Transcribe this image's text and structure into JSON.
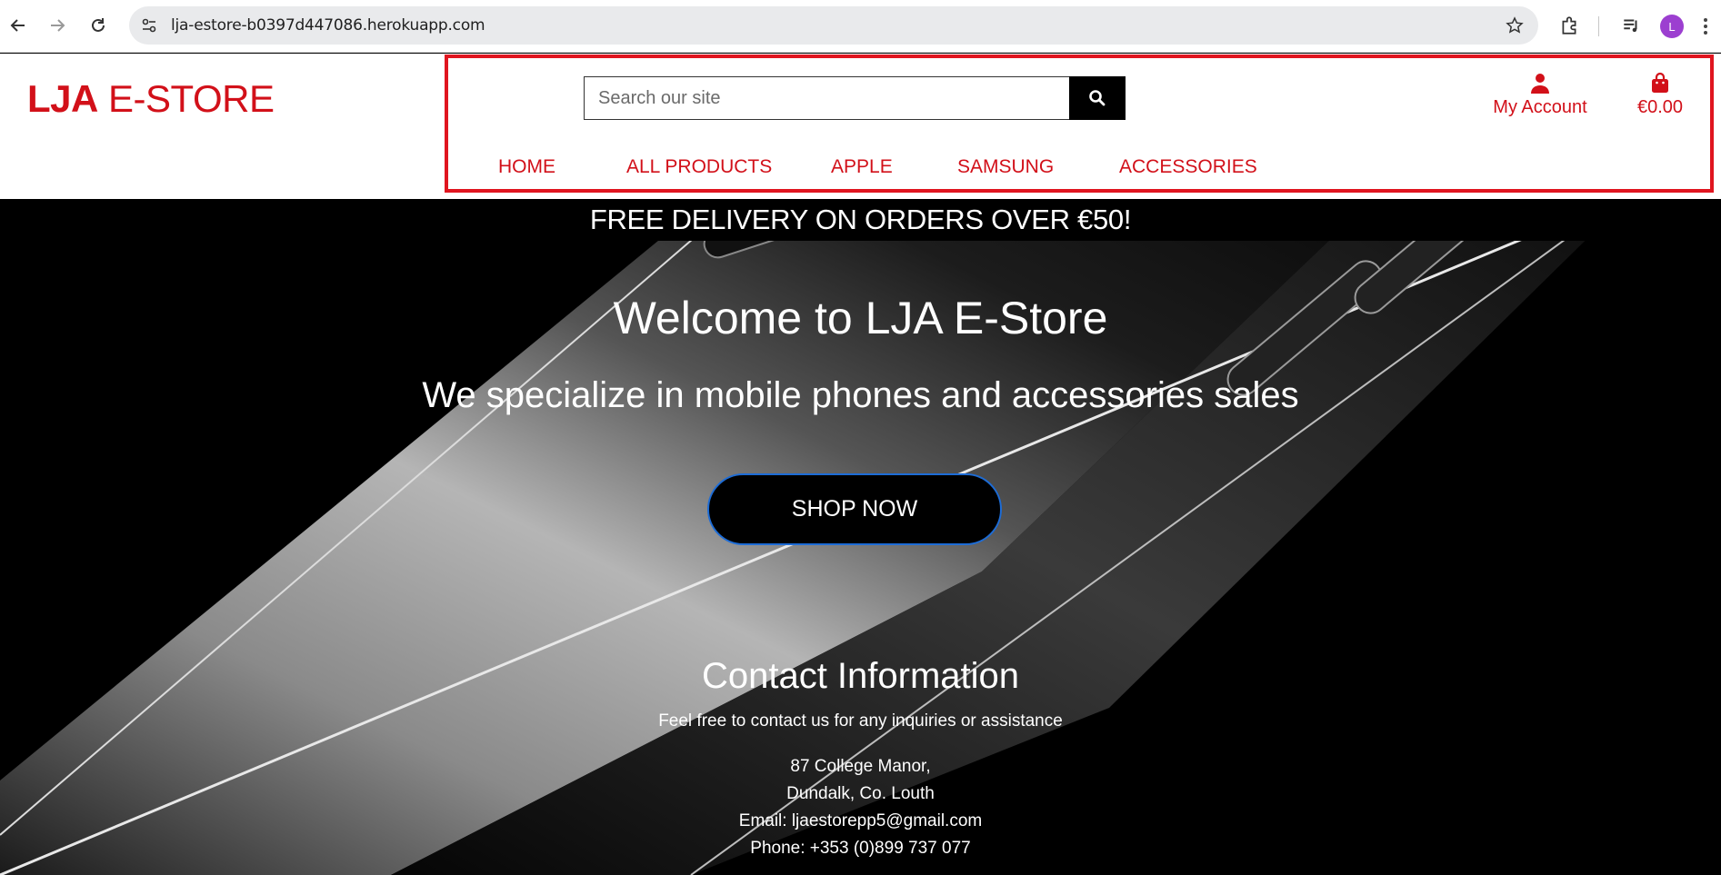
{
  "browser": {
    "url": "lja-estore-b0397d447086.herokuapp.com",
    "profile_initial": "L"
  },
  "site": {
    "logo_bold": "LJA",
    "logo_rest": " E-STORE",
    "brand_color": "#d21019",
    "search": {
      "placeholder": "Search our site"
    },
    "nav": [
      "HOME",
      "ALL PRODUCTS",
      "APPLE",
      "SAMSUNG",
      "ACCESSORIES"
    ],
    "account_label": "My Account",
    "bag_total": "€0.00"
  },
  "hero": {
    "banner": "FREE DELIVERY ON ORDERS OVER €50!",
    "title": "Welcome to LJA E-Store",
    "subtitle": "We specialize in mobile phones and accessories sales",
    "cta": "SHOP NOW"
  },
  "contact": {
    "title": "Contact Information",
    "subtitle": "Feel free to contact us for any inquiries or assistance",
    "address_line1": "87 College Manor,",
    "address_line2": "Dundalk, Co. Louth",
    "email": "Email: ljaestorepp5@gmail.com",
    "phone": "Phone: +353 (0)899 737 077"
  }
}
